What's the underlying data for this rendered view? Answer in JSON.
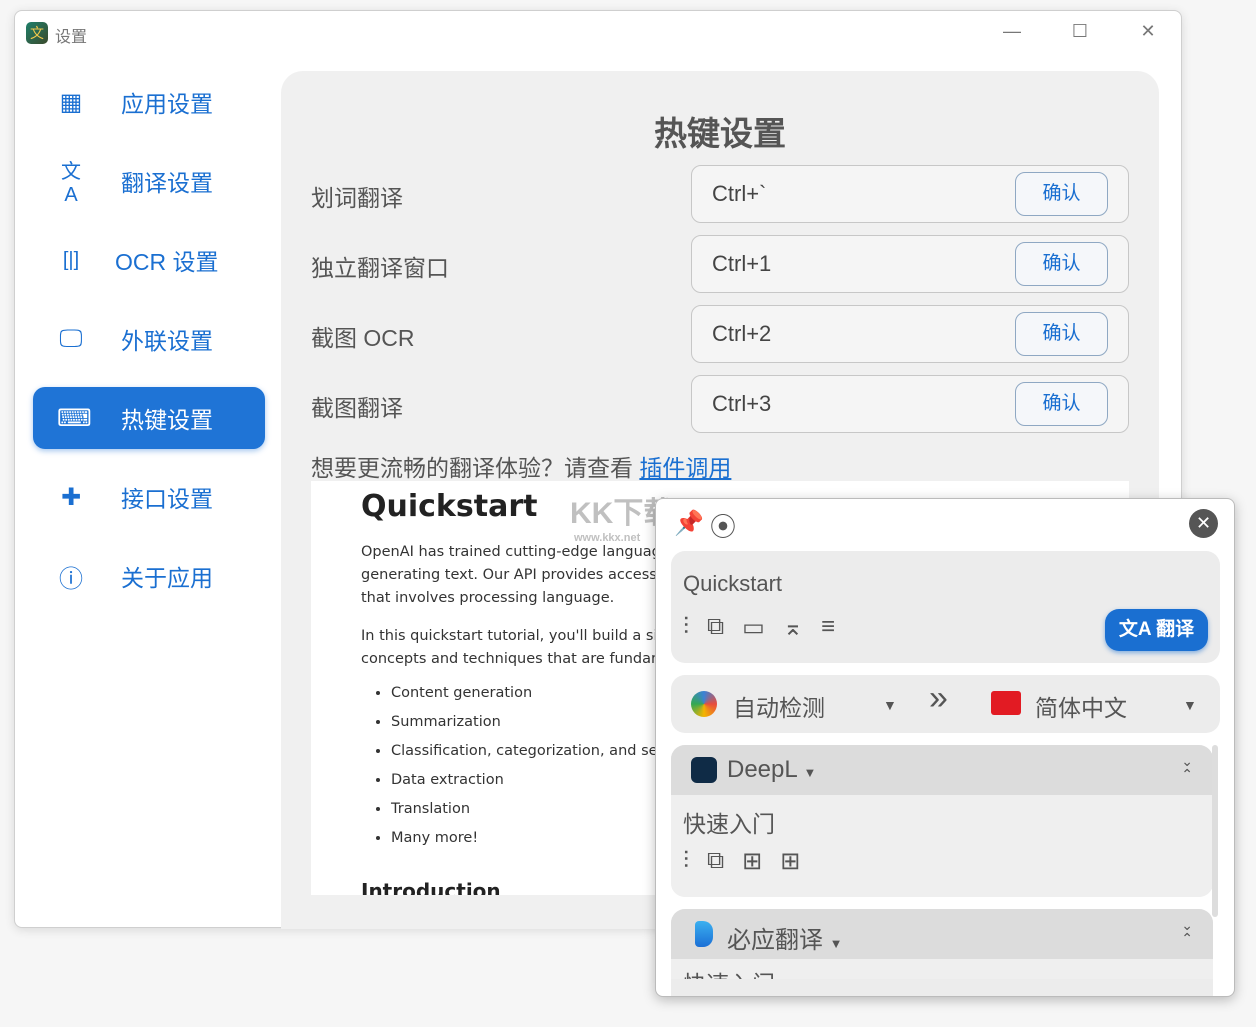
{
  "window": {
    "title": "设置",
    "icon_glyph": "文",
    "controls": {
      "minimize": "—",
      "maximize": "☐",
      "close": "✕"
    }
  },
  "sidebar": {
    "items": [
      {
        "label": "应用设置",
        "icon": "apps-icon",
        "glyph": "▦"
      },
      {
        "label": "翻译设置",
        "icon": "translate-icon",
        "glyph": "文A"
      },
      {
        "label": "OCR 设置",
        "icon": "ocr-icon",
        "glyph": "[|]"
      },
      {
        "label": "外联设置",
        "icon": "devices-icon",
        "glyph": "🖵"
      },
      {
        "label": "热键设置",
        "icon": "keyboard-icon",
        "glyph": "⌨",
        "active": true
      },
      {
        "label": "接口设置",
        "icon": "puzzle-icon",
        "glyph": "✚"
      },
      {
        "label": "关于应用",
        "icon": "info-icon",
        "glyph": "ⓘ"
      }
    ]
  },
  "main": {
    "title": "热键设置",
    "hotkeys": [
      {
        "label": "划词翻译",
        "value": "Ctrl+`",
        "button": "确认"
      },
      {
        "label": "独立翻译窗口",
        "value": "Ctrl+1",
        "button": "确认"
      },
      {
        "label": "截图 OCR",
        "value": "Ctrl+2",
        "button": "确认"
      },
      {
        "label": "截图翻译",
        "value": "Ctrl+3",
        "button": "确认"
      }
    ],
    "hint": "想要更流畅的翻译体验？请查看 ",
    "hint_link": "插件调用"
  },
  "document": {
    "title": "Quickstart",
    "p1": [
      "OpenAI has trained cutting-edge languag",
      "generating text. Our API provides access",
      "that involves processing language."
    ],
    "p2": [
      "In this quickstart tutorial, you'll build a sin",
      "concepts and techniques that are fundam"
    ],
    "list": [
      "Content generation",
      "Summarization",
      "Classification, categorization, and se",
      "Data extraction",
      "Translation",
      "Many more!"
    ],
    "next_heading": "Introduction"
  },
  "watermark": {
    "text": "KK下载",
    "url": "www.kkx.net"
  },
  "popup": {
    "source_text": "Quickstart",
    "translate_button": "翻译",
    "source_lang": "自动检测",
    "target_lang": "简体中文",
    "arrow": "»",
    "services": [
      {
        "name": "DeepL",
        "result": "快速入门",
        "color": "#0f2b46"
      },
      {
        "name": "必应翻译",
        "result": "快速入门",
        "color": "#1b8ce3"
      }
    ]
  },
  "colors": {
    "accent": "#1a6fd1",
    "panel": "#f0f0f0"
  }
}
